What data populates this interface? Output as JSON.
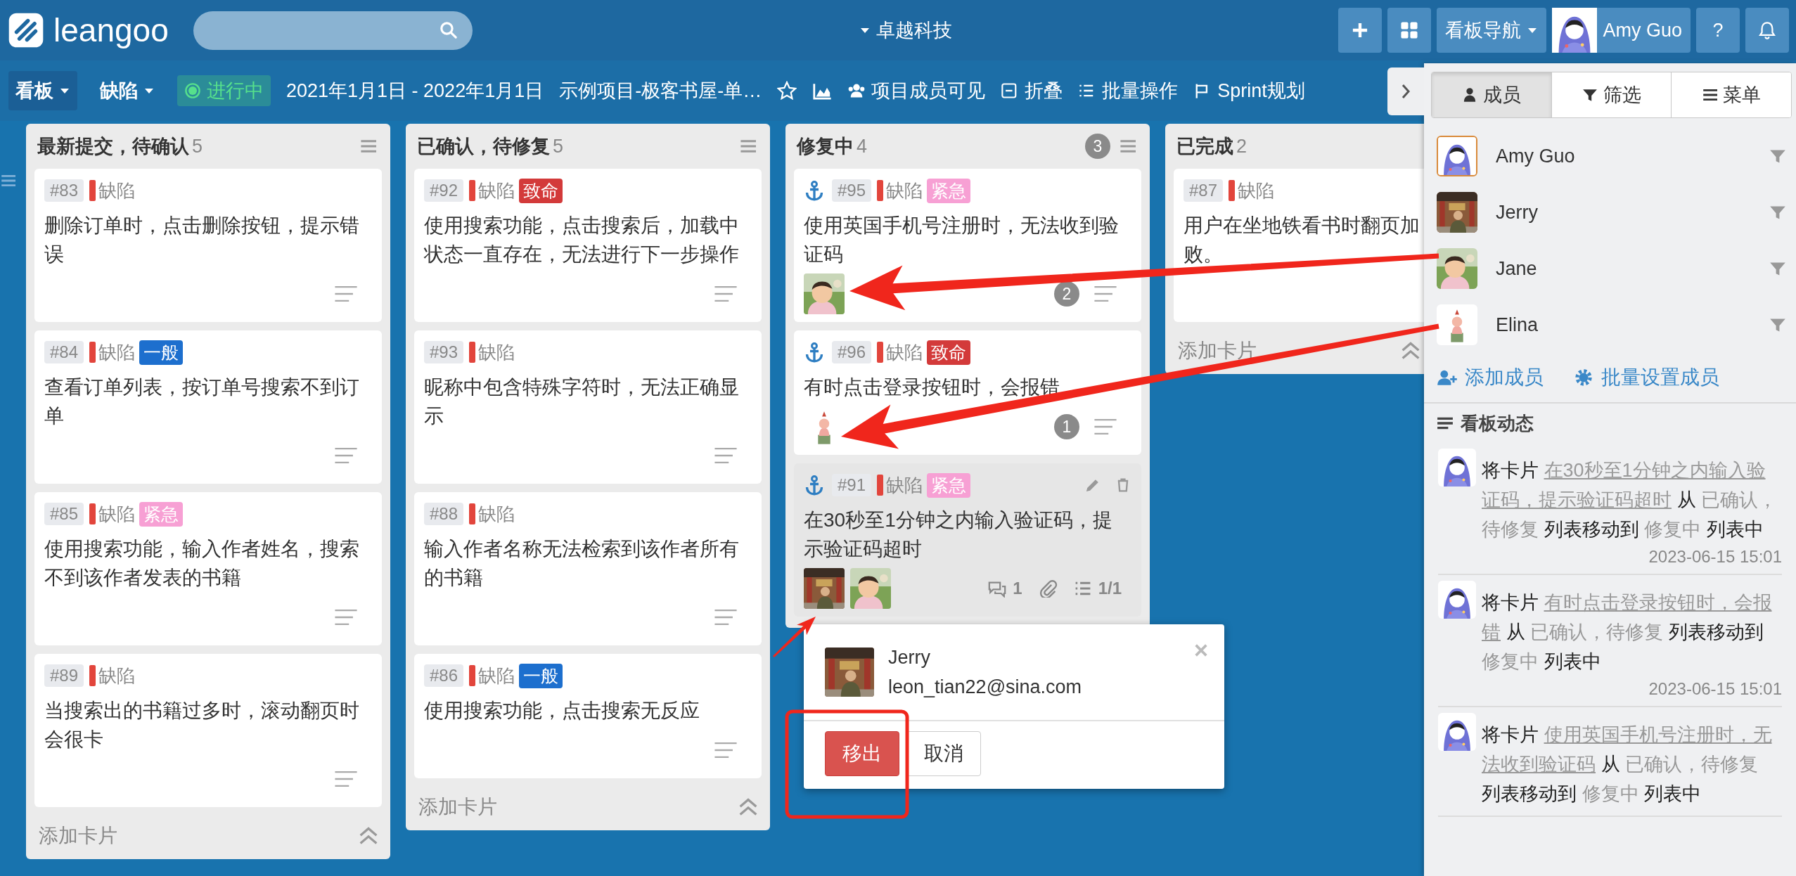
{
  "topbar": {
    "logo": "leangoo",
    "workspace": "卓越科技",
    "board_nav": "看板导航",
    "user": {
      "name": "Amy Guo"
    },
    "help": "?"
  },
  "toolbar": {
    "board_menu": "看板",
    "board_name": "缺陷",
    "status": "进行中",
    "dates": "2021年1月1日 - 2022年1月1日",
    "project": "示例项目-极客书屋-单…",
    "actions": [
      {
        "kind": "visibility",
        "label": "项目成员可见"
      },
      {
        "kind": "collapse",
        "label": "折叠"
      },
      {
        "kind": "batch",
        "label": "批量操作"
      },
      {
        "kind": "sprint",
        "label": "Sprint规划"
      }
    ]
  },
  "columns": [
    {
      "title": "最新提交，待确认",
      "count": "5",
      "add_card": "添加卡片",
      "header_menu": true,
      "cards": [
        {
          "id": "#83",
          "type": "缺陷",
          "title": "删除订单时，点击删除按钮，提示错误",
          "anchored": false,
          "hovered": false,
          "description": true,
          "attachment": false
        },
        {
          "id": "#84",
          "type": "缺陷",
          "severity": {
            "label": "一般",
            "color": "#1d6fce"
          },
          "title": "查看订单列表，按订单号搜索不到订单",
          "anchored": false,
          "hovered": false,
          "description": true,
          "attachment": false
        },
        {
          "id": "#85",
          "type": "缺陷",
          "severity": {
            "label": "紧急",
            "color": "#f7a0d4"
          },
          "title": "使用搜索功能，输入作者姓名，搜索不到该作者发表的书籍",
          "anchored": false,
          "hovered": false,
          "description": true,
          "attachment": false
        },
        {
          "id": "#89",
          "type": "缺陷",
          "title": "当搜索出的书籍过多时，滚动翻页时会很卡",
          "anchored": false,
          "hovered": false,
          "description": true,
          "attachment": false
        }
      ]
    },
    {
      "title": "已确认，待修复",
      "count": "5",
      "add_card": "添加卡片",
      "header_menu": true,
      "cards": [
        {
          "id": "#92",
          "type": "缺陷",
          "severity": {
            "label": "致命",
            "color": "#d33a3a"
          },
          "title": "使用搜索功能，点击搜索后，加载中状态一直存在，无法进行下一步操作",
          "anchored": false,
          "hovered": false,
          "description": true,
          "attachment": false
        },
        {
          "id": "#93",
          "type": "缺陷",
          "title": "昵称中包含特殊字符时，无法正确显示",
          "anchored": false,
          "hovered": false,
          "description": true,
          "attachment": false
        },
        {
          "id": "#88",
          "type": "缺陷",
          "title": "输入作者名称无法检索到该作者所有的书籍",
          "anchored": false,
          "hovered": false,
          "description": true,
          "attachment": false
        },
        {
          "id": "#86",
          "type": "缺陷",
          "severity": {
            "label": "一般",
            "color": "#1d6fce"
          },
          "title": "使用搜索功能，点击搜索无反应",
          "anchored": false,
          "hovered": false,
          "description": true,
          "attachment": false
        }
      ]
    },
    {
      "title": "修复中",
      "count": "4",
      "badge": "3",
      "header_menu": true,
      "cards": [
        {
          "id": "#95",
          "type": "缺陷",
          "severity": {
            "label": "紧急",
            "color": "#f7a0d4"
          },
          "title": "使用英国手机号注册时，无法收到验证码",
          "count": "2",
          "anchored": true,
          "hovered": false,
          "description": true,
          "attachment": false
        },
        {
          "id": "#96",
          "type": "缺陷",
          "severity": {
            "label": "致命",
            "color": "#d33a3a"
          },
          "title": "有时点击登录按钮时，会报错",
          "count": "1",
          "anchored": true,
          "hovered": false,
          "description": true,
          "attachment": false
        },
        {
          "id": "#91",
          "type": "缺陷",
          "severity": {
            "label": "紧急",
            "color": "#f7a0d4"
          },
          "title": "在30秒至1分钟之内输入验证码，提示验证码超时",
          "comments": "1",
          "checklist": "1/1",
          "anchored": true,
          "hovered": true,
          "description": false,
          "attachment": true
        }
      ]
    },
    {
      "title": "已完成",
      "count": "2",
      "add_card": "添加卡片",
      "header_menu": false,
      "cards": [
        {
          "id": "#87",
          "type": "缺陷",
          "title_lines": [
            "用户在坐地铁看书时翻页加",
            "败。"
          ],
          "anchored": false,
          "hovered": false,
          "description": false,
          "attachment": false
        }
      ]
    }
  ],
  "panel": {
    "tabs": [
      {
        "kind": "members",
        "label": "成员",
        "selected": true
      },
      {
        "kind": "filter",
        "label": "筛选",
        "selected": false
      },
      {
        "kind": "menu",
        "label": "菜单",
        "selected": false
      }
    ],
    "members": [
      {
        "name": "Amy Guo",
        "current": true
      },
      {
        "name": "Jerry",
        "current": false
      },
      {
        "name": "Jane",
        "current": false
      },
      {
        "name": "Elina",
        "current": false
      }
    ],
    "member_actions": [
      {
        "kind": "add",
        "label": "添加成员"
      },
      {
        "kind": "bulk",
        "label": "批量设置成员"
      }
    ],
    "activity": {
      "title": "看板动态",
      "items": [
        {
          "time": "2023-06-15 15:01",
          "parts": [
            {
              "kind": "text",
              "text": "将卡片"
            },
            {
              "kind": "link",
              "text": "在30秒至1分钟之内输入验证码，提示验证码超时"
            },
            {
              "kind": "text",
              "text": "从"
            },
            {
              "kind": "list",
              "text": "已确认，待修复"
            },
            {
              "kind": "text",
              "text": "列表移动到"
            },
            {
              "kind": "list",
              "text": "修复中"
            },
            {
              "kind": "text",
              "text": "列表中"
            }
          ]
        },
        {
          "time": "2023-06-15 15:01",
          "parts": [
            {
              "kind": "text",
              "text": "将卡片"
            },
            {
              "kind": "link",
              "text": "有时点击登录按钮时，会报错"
            },
            {
              "kind": "text",
              "text": "从"
            },
            {
              "kind": "list",
              "text": "已确认，待修复"
            },
            {
              "kind": "text",
              "text": "列表移动到"
            },
            {
              "kind": "list",
              "text": "修复中"
            },
            {
              "kind": "text",
              "text": "列表中"
            }
          ]
        },
        {
          "parts": [
            {
              "kind": "text",
              "text": "将卡片"
            },
            {
              "kind": "link",
              "text": "使用英国手机号注册时，无法收到验证码"
            },
            {
              "kind": "text",
              "text": "从"
            },
            {
              "kind": "list",
              "text": "已确认，待修复"
            },
            {
              "kind": "text",
              "text": "列表移动到"
            },
            {
              "kind": "list",
              "text": "修复中"
            },
            {
              "kind": "text",
              "text": "列表中"
            }
          ]
        }
      ]
    }
  },
  "popup": {
    "name": "Jerry",
    "email": "leon_tian22@sina.com",
    "buttons": [
      {
        "kind": "danger",
        "label": "移出"
      },
      {
        "kind": "default",
        "label": "取消"
      }
    ]
  },
  "annotations": [
    {
      "kind": "arrow"
    },
    {
      "kind": "arrow"
    },
    {
      "kind": "arrow"
    },
    {
      "kind": "frame"
    }
  ]
}
